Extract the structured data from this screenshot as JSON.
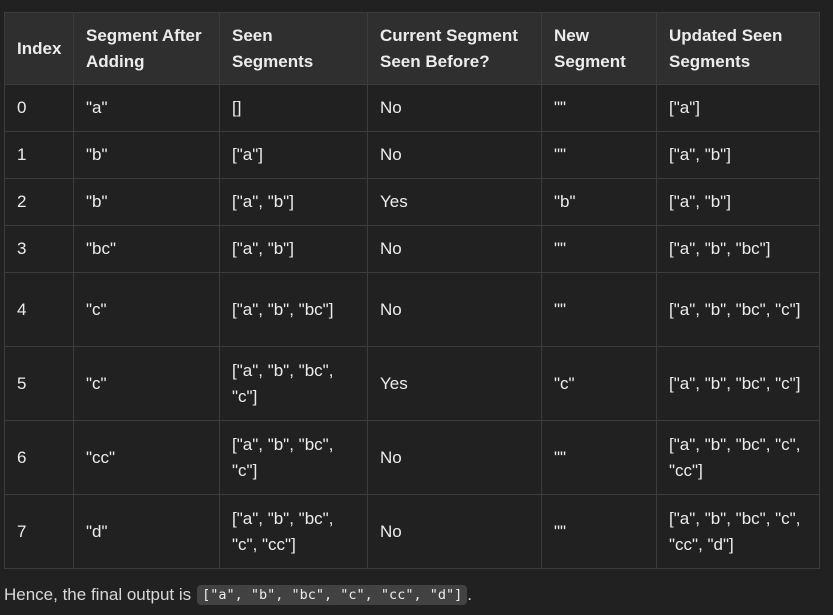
{
  "table": {
    "headers": [
      "Index",
      "Segment After Adding",
      "Seen Segments",
      "Current Segment Seen Before?",
      "New Segment",
      "Updated Seen Segments"
    ],
    "rows": [
      [
        "0",
        "\"a\"",
        "[]",
        "No",
        "\"\"",
        "[\"a\"]"
      ],
      [
        "1",
        "\"b\"",
        "[\"a\"]",
        "No",
        "\"\"",
        "[\"a\", \"b\"]"
      ],
      [
        "2",
        "\"b\"",
        "[\"a\", \"b\"]",
        "Yes",
        "\"b\"",
        "[\"a\", \"b\"]"
      ],
      [
        "3",
        "\"bc\"",
        "[\"a\", \"b\"]",
        "No",
        "\"\"",
        "[\"a\", \"b\", \"bc\"]"
      ],
      [
        "4",
        "\"c\"",
        "[\"a\", \"b\", \"bc\"]",
        "No",
        "\"\"",
        "[\"a\", \"b\", \"bc\", \"c\"]"
      ],
      [
        "5",
        "\"c\"",
        "[\"a\", \"b\", \"bc\", \"c\"]",
        "Yes",
        "\"c\"",
        "[\"a\", \"b\", \"bc\", \"c\"]"
      ],
      [
        "6",
        "\"cc\"",
        "[\"a\", \"b\", \"bc\", \"c\"]",
        "No",
        "\"\"",
        "[\"a\", \"b\", \"bc\", \"c\", \"cc\"]"
      ],
      [
        "7",
        "\"d\"",
        "[\"a\", \"b\", \"bc\", \"c\", \"cc\"]",
        "No",
        "\"\"",
        "[\"a\", \"b\", \"bc\", \"c\", \"cc\", \"d\"]"
      ]
    ]
  },
  "footer": {
    "text": "Hence, the final output is",
    "code": "[\"a\", \"b\", \"bc\", \"c\", \"cc\", \"d\"]",
    "trailing": "."
  }
}
